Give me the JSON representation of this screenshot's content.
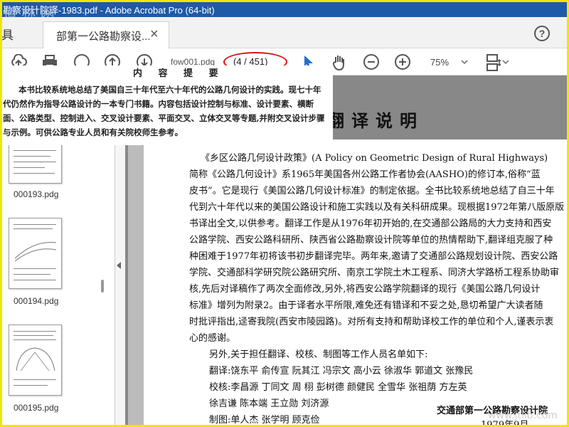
{
  "window": {
    "title": "勘察设计院译-1983.pdf - Adobe Acrobat Pro (64-bit)"
  },
  "tabs": {
    "tools_label": "具",
    "document_tab": "部第一公路勘察设...",
    "close": "×",
    "help": "?"
  },
  "toolbar": {
    "page_file": "fow001.pdg",
    "page_counter": "(4 / 451)",
    "zoom": "75%"
  },
  "sidebar": {
    "thumbnails": [
      {
        "label": "000193.pdg"
      },
      {
        "label": "000194.pdg"
      },
      {
        "label": "000195.pdg"
      }
    ]
  },
  "overlay": {
    "title": "内 容 提 要",
    "lines": [
      "本书比较系统地总结了美国自三十年代至六十年代的公路几何设计的实践。现七十年",
      "代仍然作为指导公路设计的一本专门书籍。内容包括设计控制与标准、设计要素、横断",
      "面、公路类型、控制进入、交叉设计要素、平面交叉、立体交叉等专题,并附交叉设计步骤",
      "与示例。可供公路专业人员和有关院校师生参考。"
    ]
  },
  "document": {
    "heading": "翻译说明",
    "paragraph": [
      "《乡区公路几何设计政策》(A Policy on Geometric Design of Rural Highways)",
      "简称《公路几何设计》系1965年美国各州公路工作者协会(AASHO)的修订本,俗称“蓝",
      "皮书”。它是现行《美国公路几何设计标准》的制定依据。全书比较系统地总结了自三十年",
      "代到六十年代以来的美国公路设计和施工实践以及有关科研成果。现根据1972年第八版原版",
      "书译出全文,以供参考。翻译工作是从1976年初开始的,在交通部公路局的大力支持和西安",
      "公路学院、西安公路科研所、陕西省公路勘察设计院等单位的热情帮助下,翻译组克服了种",
      "种困难于1977年初将该书初步翻译完毕。两年来,邀请了交通部公路规划设计院、西安公路",
      "学院、交通部科学研究院公路研究所、南京工学院土木工程系、同济大学路桥工程系协助审",
      "核,先后对译稿作了两次全面修改,另外,将西安公路学院翻译的现行《美国公路几何设计",
      "标准》增列为附录2。由于译者水平所限,难免还有错译和不妥之处,恳切希望广大读者随",
      "时批评指出,迳寄我院(西安市陵园路)。对所有支持和帮助译校工作的单位和个人,谨表示衷",
      "心的感谢。"
    ],
    "staff_intro": "另外,关于担任翻译、校核、制图等工作人员名单如下:",
    "staff": [
      "翻译:饶东平   俞传宣   阮其江   冯宗文   高小云   徐淑华   郭道文   张豫民",
      "校核:李昌源   丁同文   周  栩   彭树德   颜健民   全雪华   张祖荫   方左英",
      "      徐吉谦   陈本端   王立勋   刘济源",
      "制图:单人杰   张学明   顾克俭"
    ],
    "signature": "交通部第一公路勘察设计院",
    "date": "1979年9月"
  },
  "watermark": {
    "top": "道 林 网",
    "bottom": "www.jtlib.com"
  },
  "colors": {
    "titlebar": "#1e5aa8",
    "annotation_oval": "#e01010",
    "frame": "#f2e600"
  }
}
